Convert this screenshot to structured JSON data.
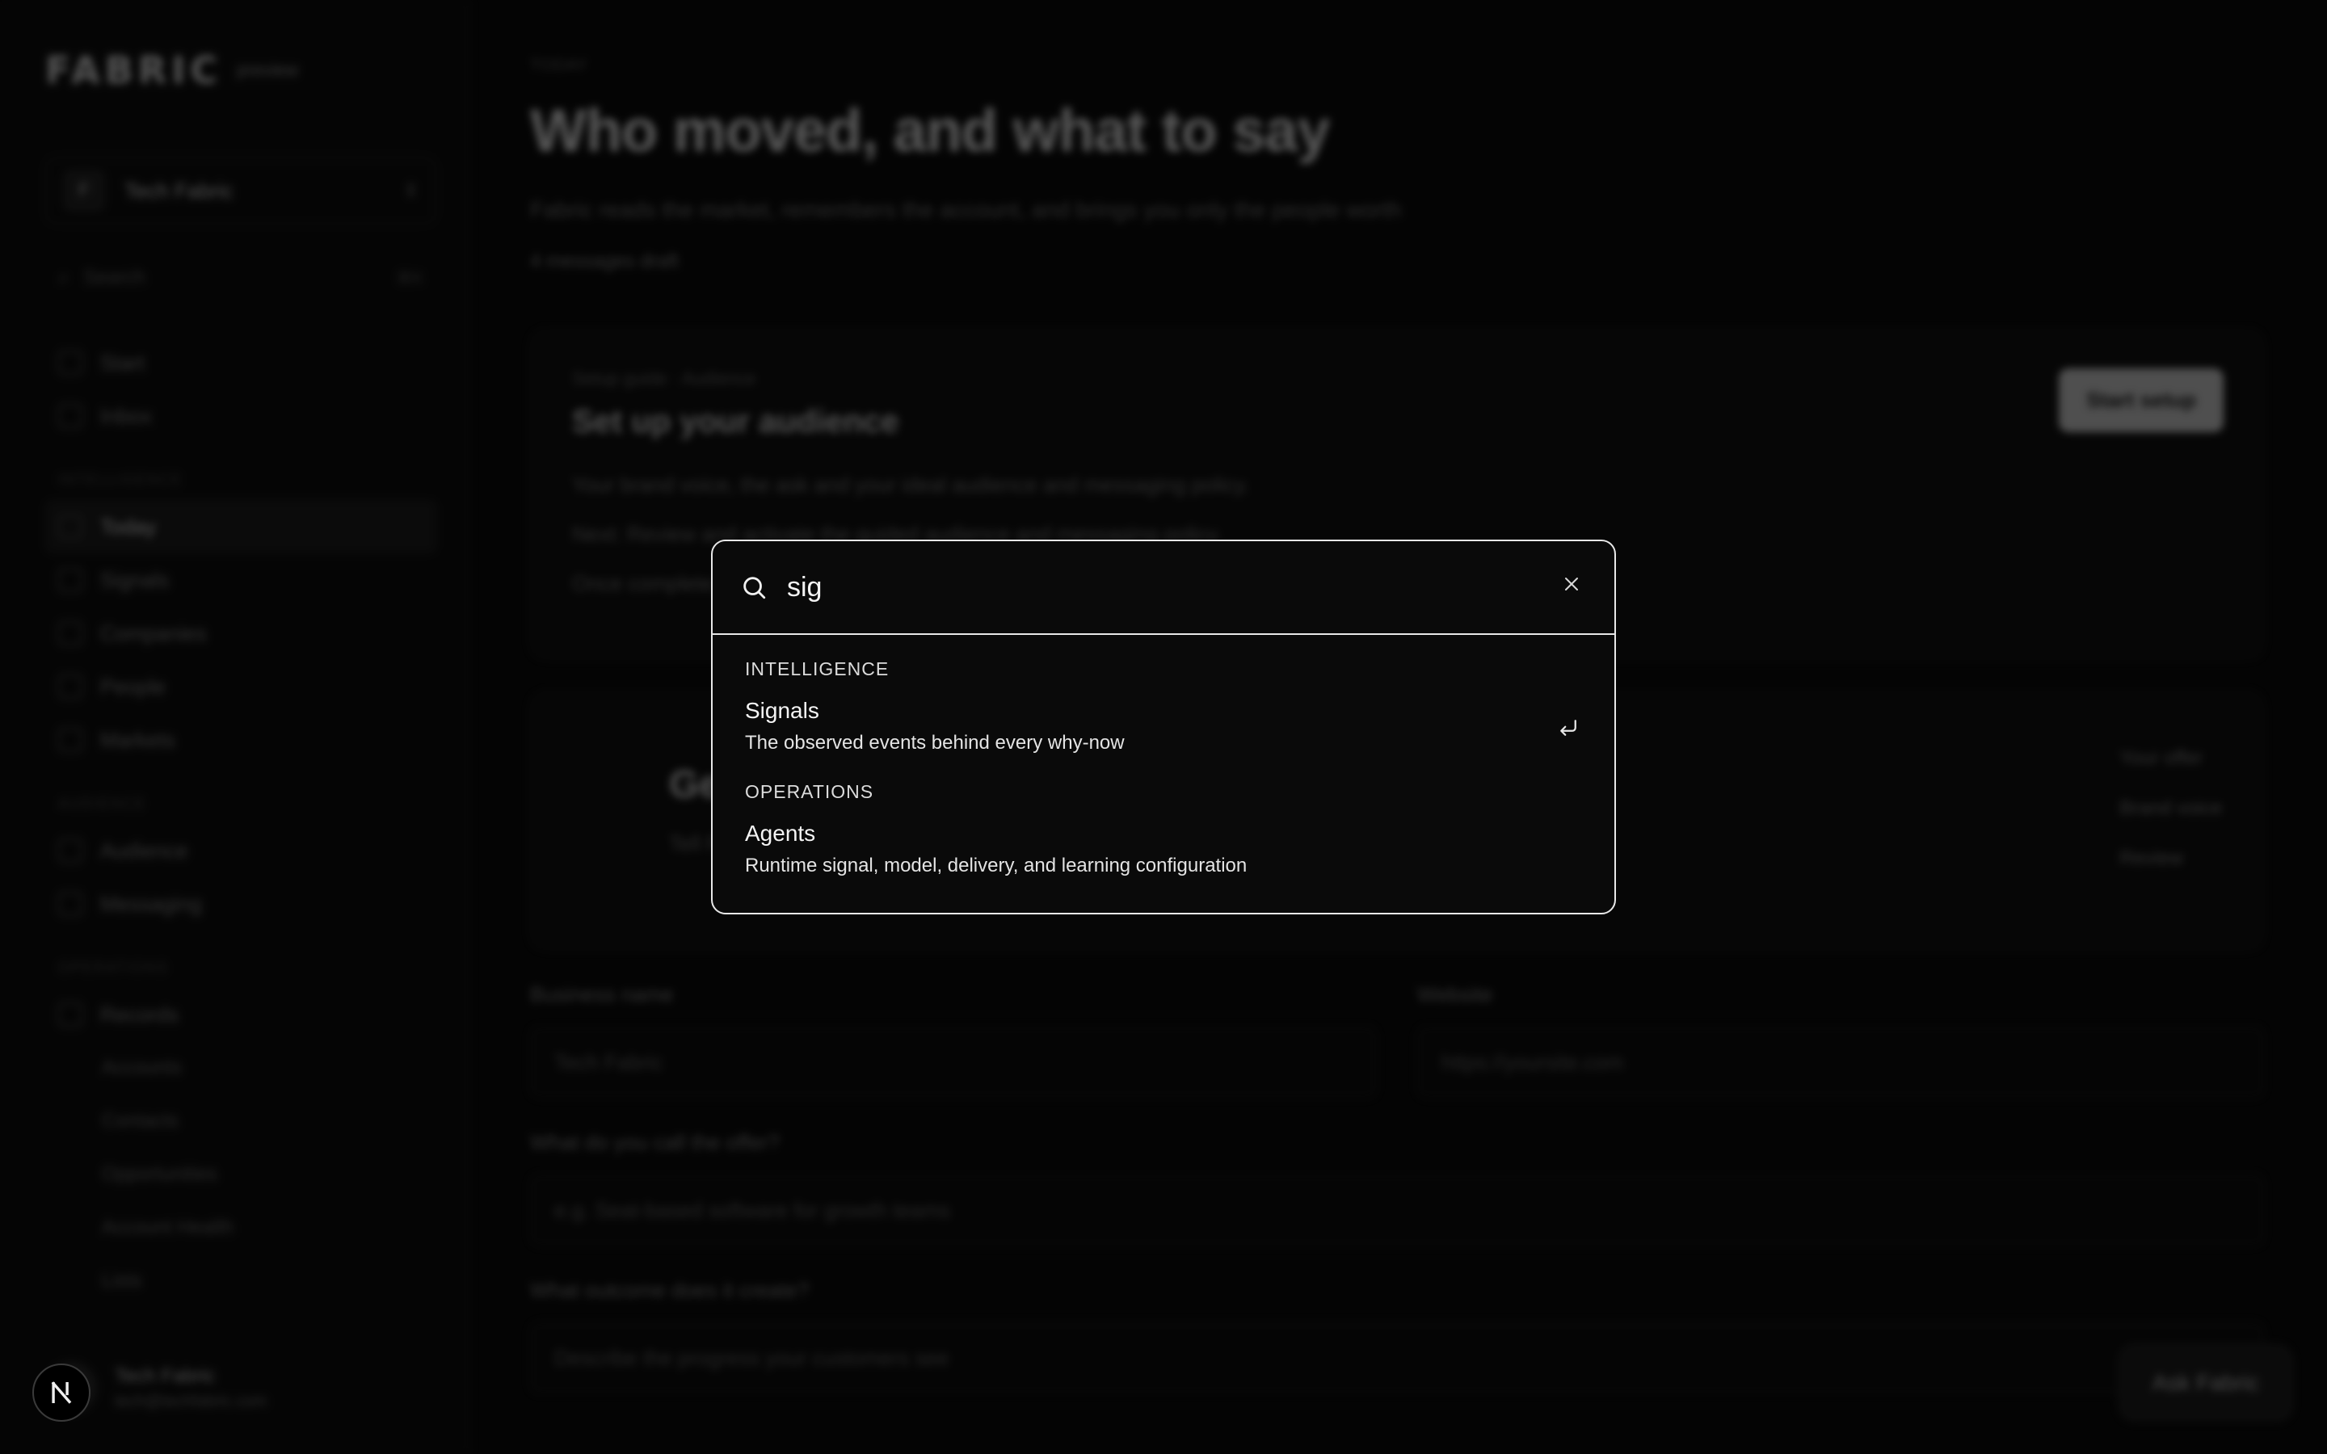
{
  "sidebar": {
    "brand": "FABRIC",
    "brand_tag": "preview",
    "workspace": {
      "initial": "F",
      "name": "Tech Fabric"
    },
    "search": {
      "label": "Search",
      "shortcut": "⌘K"
    },
    "top_items": [
      {
        "label": "Start"
      },
      {
        "label": "Inbox"
      }
    ],
    "groups": [
      {
        "label": "Intelligence",
        "items": [
          {
            "label": "Today",
            "active": true
          },
          {
            "label": "Signals"
          },
          {
            "label": "Companies"
          },
          {
            "label": "People"
          },
          {
            "label": "Markets"
          }
        ]
      },
      {
        "label": "Audience",
        "items": [
          {
            "label": "Audience"
          },
          {
            "label": "Messaging"
          }
        ]
      },
      {
        "label": "Operations",
        "items": [
          {
            "label": "Records"
          }
        ]
      }
    ],
    "sub_items": [
      {
        "label": "Accounts"
      },
      {
        "label": "Contacts"
      },
      {
        "label": "Opportunities"
      },
      {
        "label": "Account Health"
      },
      {
        "label": "Lists"
      }
    ],
    "user": {
      "name": "Tech Fabric",
      "email": "tech@techfabric.com"
    }
  },
  "main": {
    "eyebrow": "TODAY",
    "title": "Who moved, and what to say",
    "subtitle": "Fabric reads the market, remembers the account, and brings you only the people worth",
    "meta": "4 messages draft",
    "setup_card": {
      "crumb": "Setup guide · Audience",
      "title": "Set up your audience",
      "lines": [
        "Your brand voice, the ask and your ideal audience and messaging policy.",
        "Next: Review and activate the guided audience and messaging policy.",
        "Once complete, Fabric will begin drafting."
      ],
      "button": "Start setup"
    },
    "second_card": {
      "title": "Get started",
      "line": "Tell Fabric about your business so it can tailor signals and messaging",
      "side": [
        "Your offer",
        "Brand voice",
        "Review"
      ]
    },
    "form": {
      "business_label": "Business name",
      "business_value": "Tech Fabric",
      "website_label": "Website",
      "website_placeholder": "https://yoursite.com",
      "offer_label": "What do you call the offer?",
      "offer_placeholder": "e.g. Seat-based software for growth teams",
      "outcome_label": "What outcome does it create?",
      "outcome_placeholder": "Describe the progress your customers see"
    },
    "floating_button": "Ask Fabric"
  },
  "palette": {
    "query": "sig",
    "groups": [
      {
        "label": "INTELLIGENCE",
        "results": [
          {
            "title": "Signals",
            "description": "The observed events behind every why-now",
            "selected": true
          }
        ]
      },
      {
        "label": "OPERATIONS",
        "results": [
          {
            "title": "Agents",
            "description": "Runtime signal, model, delivery, and learning configuration",
            "selected": false
          }
        ]
      }
    ]
  },
  "dev_badge": {
    "letter": "N"
  }
}
